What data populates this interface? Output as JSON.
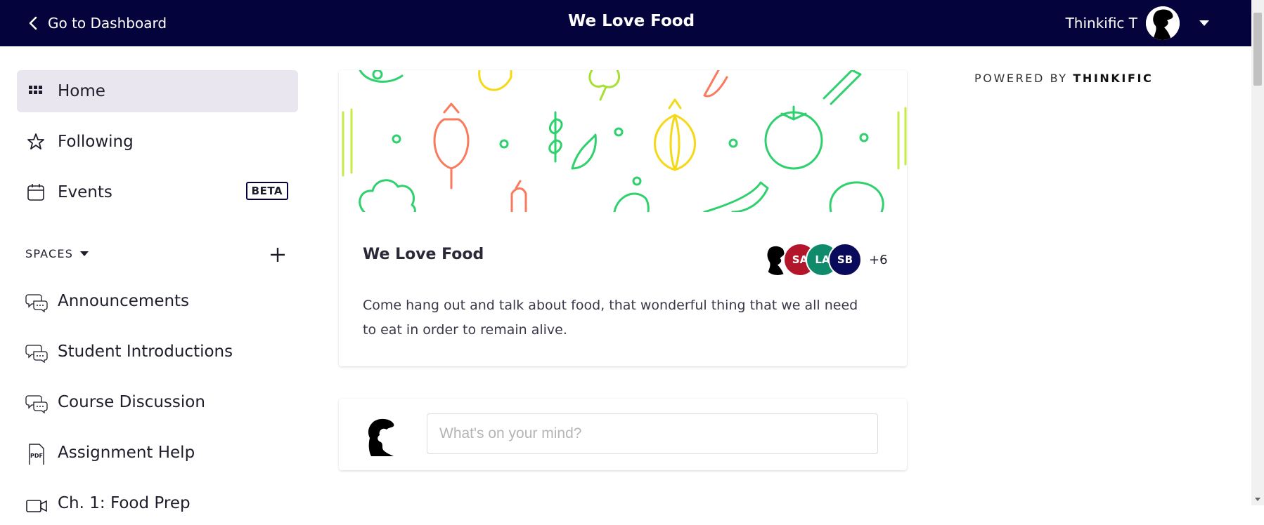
{
  "topbar": {
    "back_label": "Go to Dashboard",
    "title": "We Love Food",
    "user_name": "Thinkific T",
    "background": "#05033b"
  },
  "sidebar": {
    "nav": [
      {
        "label": "Home",
        "icon": "grid-icon",
        "active": true
      },
      {
        "label": "Following",
        "icon": "star-icon"
      },
      {
        "label": "Events",
        "icon": "calendar-icon",
        "badge": "BETA"
      }
    ],
    "spaces_header": "SPACES",
    "spaces": [
      {
        "label": "Announcements",
        "icon": "chat-bubbles-icon"
      },
      {
        "label": "Student Introductions",
        "icon": "chat-bubbles-icon"
      },
      {
        "label": "Course Discussion",
        "icon": "chat-bubbles-icon"
      },
      {
        "label": "Assignment Help",
        "icon": "pdf-icon",
        "icon_text": "PDF"
      },
      {
        "label": "Ch. 1: Food Prep",
        "icon": "video-icon"
      }
    ]
  },
  "space_card": {
    "title": "We Love Food",
    "description": "Come hang out and talk about food, that wonderful thing that we all need to eat in order to remain alive.",
    "members": [
      {
        "initials": "",
        "color": "#ffffff",
        "type": "silhouette"
      },
      {
        "initials": "SA",
        "color": "#b3162a"
      },
      {
        "initials": "LA",
        "color": "#0f8a6a"
      },
      {
        "initials": "SB",
        "color": "#0a0a5a"
      }
    ],
    "more_members": "+6"
  },
  "composer": {
    "placeholder": "What's on your mind?",
    "value": ""
  },
  "powered_by": {
    "prefix": "POWERED BY",
    "brand": "THINKIFIC"
  }
}
